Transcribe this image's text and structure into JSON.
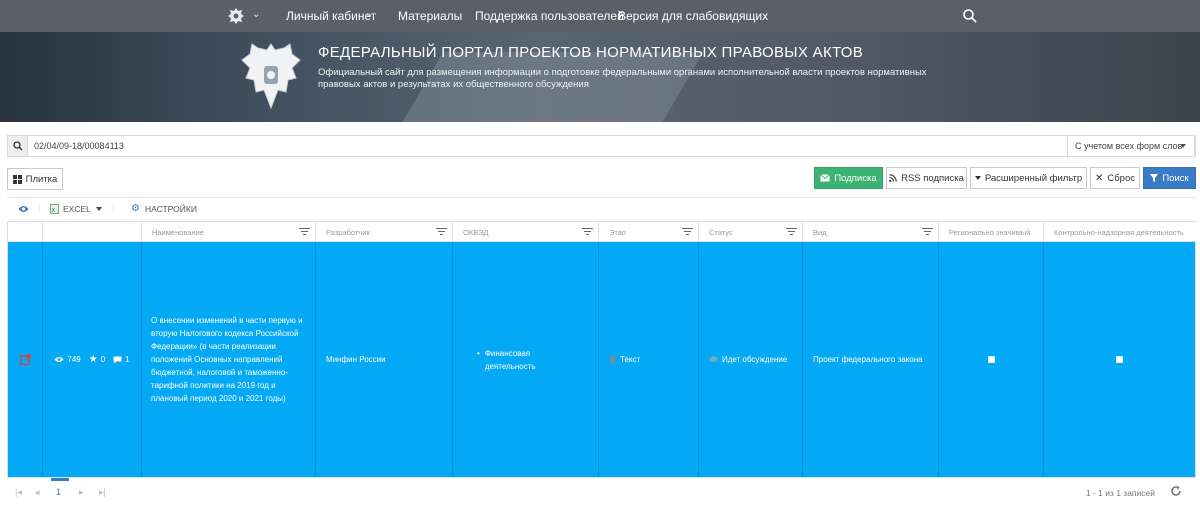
{
  "nav": {
    "emblem_icon": "russian-coat-of-arms-icon",
    "items": [
      {
        "label": "Личный кабинет",
        "has_dropdown": true
      },
      {
        "label": "Материалы",
        "has_dropdown": false
      },
      {
        "label": "Поддержка пользователей",
        "has_dropdown": false
      },
      {
        "label": "Версия для слабовидящих",
        "has_dropdown": false
      }
    ],
    "search_icon": "search-icon"
  },
  "banner": {
    "title": "ФЕДЕРАЛЬНЫЙ ПОРТАЛ ПРОЕКТОВ НОРМАТИВНЫХ ПРАВОВЫХ АКТОВ",
    "subtitle": "Официальный сайт для размещения информации о подготовке федеральными органами исполнительной власти проектов нормативных правовых актов и результатах их общественного обсуждения"
  },
  "search": {
    "value": "02/04/09-18/00084113",
    "mode": "С учетом всех форм слов"
  },
  "buttons": {
    "tile": "Плитка",
    "subscribe": "Подписка",
    "rss": "RSS подписка",
    "advanced_filter": "Расширенный фильтр",
    "reset": "Сброс",
    "search": "Поиск"
  },
  "toolbar": {
    "excel": "EXCEL",
    "settings": "НАСТРОЙКИ"
  },
  "table": {
    "columns": [
      "Наименование",
      "Разработчик",
      "ОКВЭД",
      "Этап",
      "Статус",
      "Вид",
      "Регионально значимый",
      "Контрольно-надзорная деятельность"
    ],
    "rows": [
      {
        "views": "749",
        "stars": "0",
        "comments": "1",
        "name": "О внесении изменений в части первую и вторую Налогового кодекса Российской Федерации» (в части реализации положений Основных направлений бюджетной, налоговой и таможенно-тарифной политики на 2019 год и плановый период 2020 и 2021 годы)",
        "developer": "Минфин России",
        "okved": "Финансовая деятельность",
        "stage": "Текст",
        "status": "Идет обсуждение",
        "kind": "Проект федерального закона",
        "regional": false,
        "control": false
      }
    ]
  },
  "pager": {
    "first": "|◂",
    "prev": "◂",
    "page": "1",
    "next": "▸",
    "last": "▸|",
    "info": "1 - 1 из 1 записей"
  },
  "colors": {
    "nav_bg": "#5b6068",
    "row_selected": "#03a9f4",
    "green": "#3cb371",
    "blue": "#3a7bc8"
  }
}
